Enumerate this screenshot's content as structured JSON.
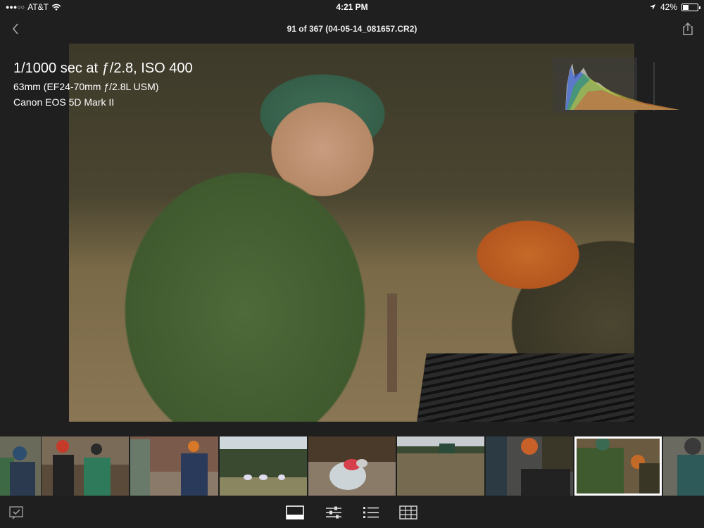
{
  "status_bar": {
    "carrier": "AT&T",
    "time": "4:21 PM",
    "battery": "42%",
    "battery_level": 0.42
  },
  "nav": {
    "title": "91 of 367 (04-05-14_081657.CR2)"
  },
  "photo_info": {
    "exposure": "1/1000 sec at ƒ/2.8, ISO 400",
    "lens": "63mm (EF24-70mm ƒ/2.8L USM)",
    "camera": "Canon EOS 5D Mark II"
  },
  "filmstrip": {
    "selected_index": 7,
    "thumbnail_count": 9
  },
  "toolbar": {
    "buttons": [
      "loupe-view-icon",
      "adjust-sliders-icon",
      "list-info-icon",
      "grid-view-icon"
    ]
  },
  "colors": {
    "background": "#1f1f1f",
    "selected_outline": "#ffffff"
  }
}
